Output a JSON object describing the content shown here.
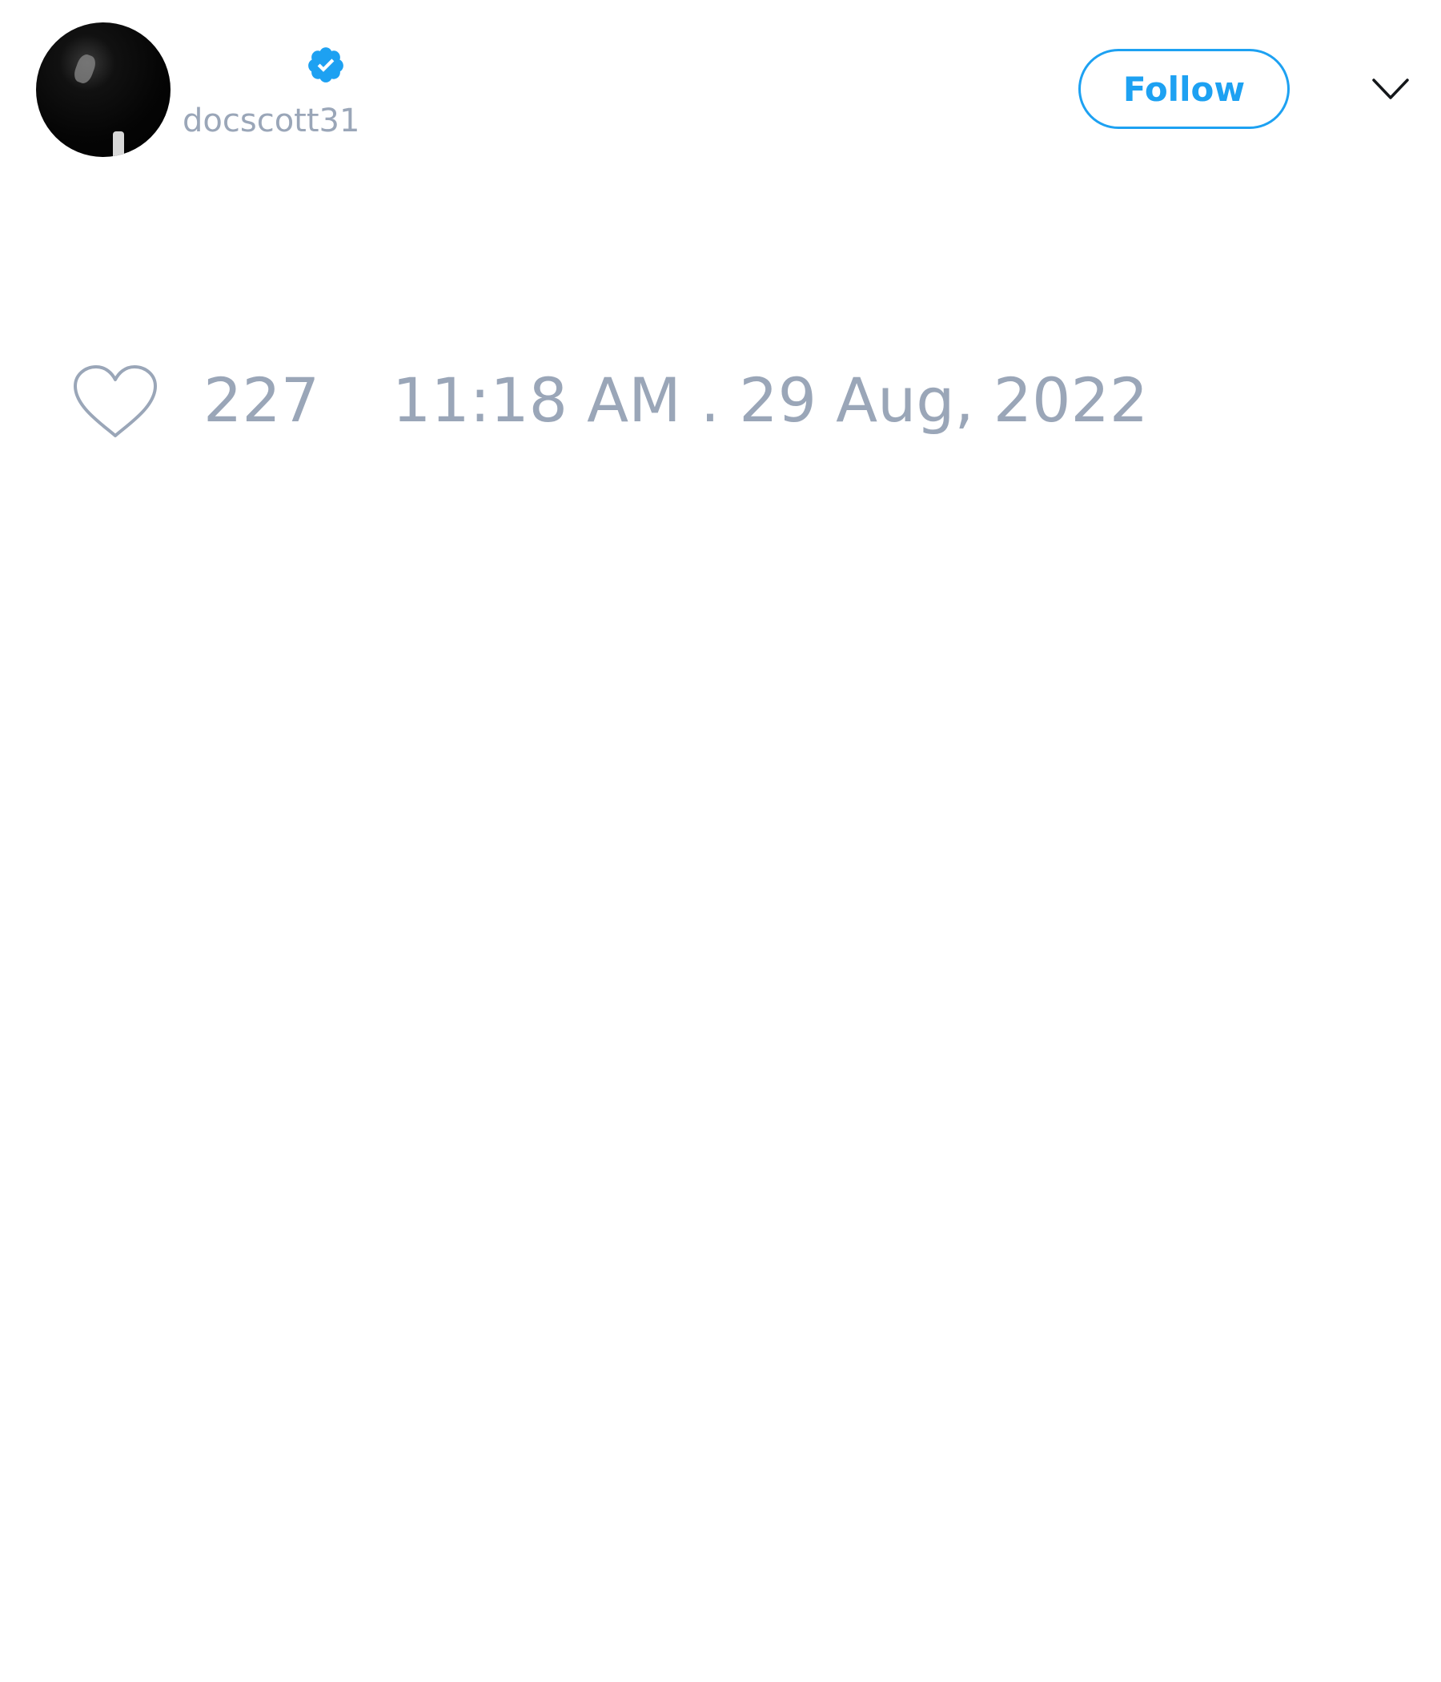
{
  "user": {
    "display_name": "",
    "handle": "docscott31",
    "verified": true
  },
  "header": {
    "follow_label": "Follow",
    "more_icon": "chevron-down-icon"
  },
  "tweet": {
    "like_count": "227",
    "timestamp": "11:18 AM . 29 Aug, 2022",
    "like_icon": "heart-outline-icon"
  },
  "colors": {
    "accent": "#1da1f2",
    "muted_text": "#9aa6b8",
    "background": "#ffffff"
  }
}
